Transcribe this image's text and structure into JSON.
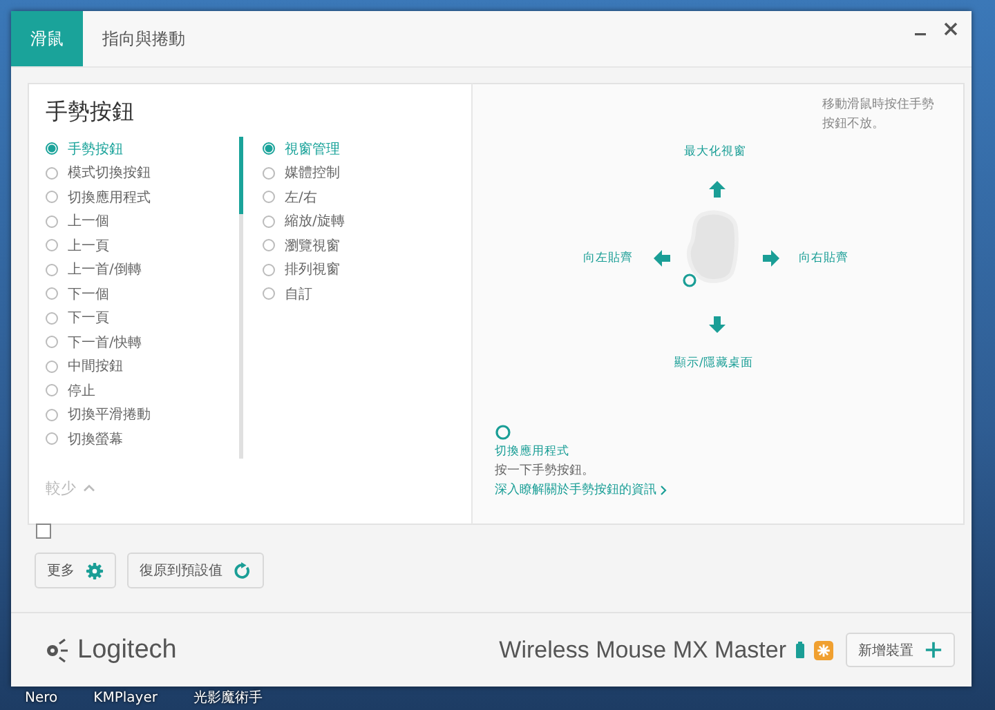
{
  "window": {
    "controls": [
      {
        "kind": "minimize"
      },
      {
        "kind": "close"
      }
    ]
  },
  "tabs": [
    {
      "label": "滑鼠",
      "selected": true
    },
    {
      "label": "指向與捲動",
      "selected": false
    }
  ],
  "panel": {
    "title": "手勢按鈕",
    "actions": [
      {
        "label": "手勢按鈕",
        "selected": true
      },
      {
        "label": "模式切換按鈕",
        "selected": false
      },
      {
        "label": "切換應用程式",
        "selected": false
      },
      {
        "label": "上一個",
        "selected": false
      },
      {
        "label": "上一頁",
        "selected": false
      },
      {
        "label": "上一首/倒轉",
        "selected": false
      },
      {
        "label": "下一個",
        "selected": false
      },
      {
        "label": "下一頁",
        "selected": false
      },
      {
        "label": "下一首/快轉",
        "selected": false
      },
      {
        "label": "中間按鈕",
        "selected": false
      },
      {
        "label": "停止",
        "selected": false
      },
      {
        "label": "切換平滑捲動",
        "selected": false
      },
      {
        "label": "切換螢幕",
        "selected": false
      }
    ],
    "modes": [
      {
        "label": "視窗管理",
        "selected": true
      },
      {
        "label": "媒體控制",
        "selected": false
      },
      {
        "label": "左/右",
        "selected": false
      },
      {
        "label": "縮放/旋轉",
        "selected": false
      },
      {
        "label": "瀏覽視窗",
        "selected": false
      },
      {
        "label": "排列視窗",
        "selected": false
      },
      {
        "label": "自訂",
        "selected": false
      }
    ],
    "less_toggle": "較少",
    "hint": "移動滑鼠時按住手勢按鈕不放。",
    "gestures": [
      {
        "kind": "up",
        "label": "最大化視窗"
      },
      {
        "kind": "left",
        "label": "向左貼齊"
      },
      {
        "kind": "right",
        "label": "向右貼齊"
      },
      {
        "kind": "down",
        "label": "顯示/隱藏桌面"
      }
    ],
    "click_action": {
      "title": "切換應用程式",
      "description": "按一下手勢按鈕。",
      "link": "深入瞭解關於手勢按鈕的資訊"
    }
  },
  "checkbox": {
    "checked": false
  },
  "buttons": [
    {
      "kind": "more",
      "label": "更多"
    },
    {
      "kind": "reset",
      "label": "復原到預設值"
    }
  ],
  "footer": {
    "brand": "Logitech",
    "device": "Wireless Mouse MX Master",
    "add_button": "新增裝置"
  },
  "desktop": {
    "taskbar_labels": [
      "Nero",
      "KMPlayer",
      "光影魔術手"
    ]
  }
}
